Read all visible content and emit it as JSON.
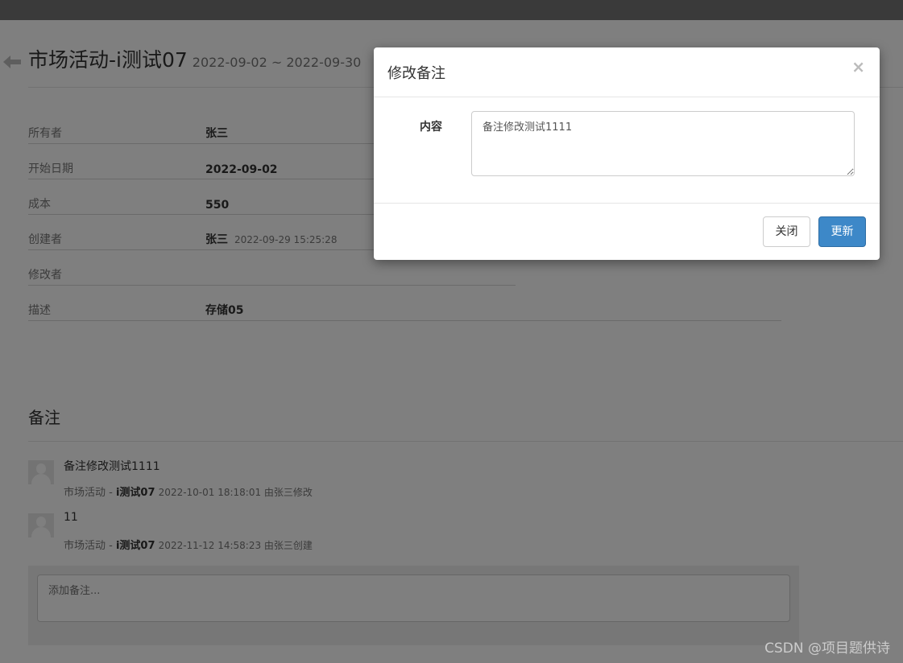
{
  "page": {
    "title": "市场活动-i测试07",
    "date_range": "2022-09-02 ~ 2022-09-30"
  },
  "details": {
    "owner_label": "所有者",
    "owner_value": "张三",
    "start_label": "开始日期",
    "start_value": "2022-09-02",
    "cost_label": "成本",
    "cost_value": "550",
    "creator_label": "创建者",
    "creator_value": "张三",
    "create_time": "2022-09-29 15:25:28",
    "editor_label": "修改者",
    "desc_label": "描述",
    "desc_value": "存储05"
  },
  "notes": {
    "title": "备注",
    "items": [
      {
        "text": "备注修改测试1111",
        "source": "市场活动 - ",
        "activity": "i测试07",
        "meta": "2022-10-01 18:18:01 由张三修改"
      },
      {
        "text": "11",
        "source": "市场活动 - ",
        "activity": "i测试07",
        "meta": "2022-11-12 14:58:23 由张三创建"
      }
    ],
    "add_placeholder": "添加备注..."
  },
  "modal": {
    "title": "修改备注",
    "close_symbol": "×",
    "content_label": "内容",
    "content_value": "备注修改测试1111",
    "close_button": "关闭",
    "update_button": "更新"
  },
  "watermark": "CSDN @项目题供诗",
  "colors": {
    "topbar": "#3a3a3a",
    "primary_button": "#3d88c8"
  }
}
